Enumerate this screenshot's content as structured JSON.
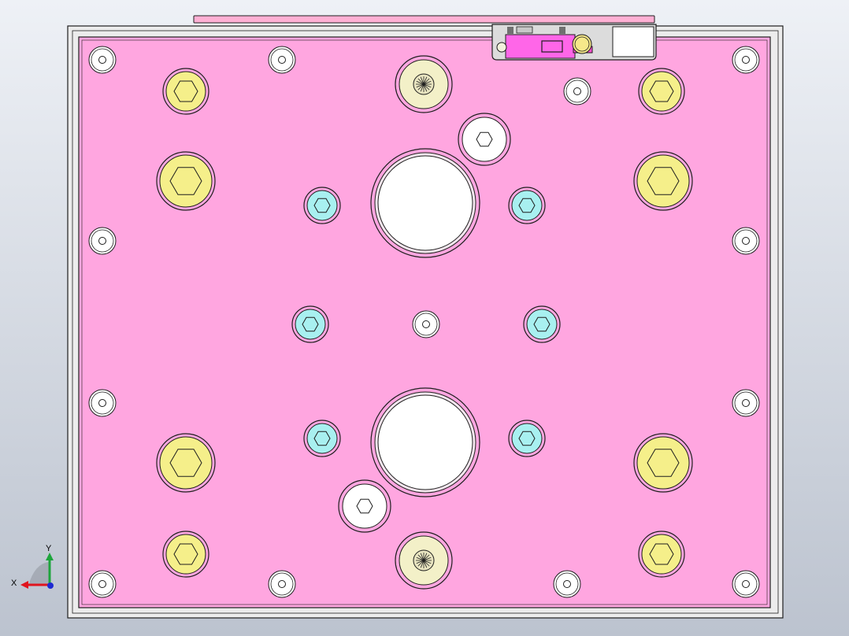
{
  "title": "",
  "view": {
    "background_top": "#eef1f6",
    "background_bottom": "#bcc3cf",
    "outline_color": "#1e1e1e"
  },
  "triad": {
    "x_label": "X",
    "y_label": "Y",
    "x_color": "#e0141e",
    "y_color": "#1ea53c",
    "z_color": "#1e2ad2"
  },
  "plate": {
    "base_color": "#ececec",
    "face_color": "#ffa6e0",
    "top_strip_color": "#ffb0d4",
    "pocket_color": "#dcdcdc"
  },
  "sensor": {
    "body_color": "#ff66e8",
    "label_color": "#ff4ed0",
    "lens_color": "#f6e88a"
  },
  "holes": {
    "large_bore_color": "#ffffff",
    "guide_bushing_color": "#f3f0c8",
    "large_cap_screw_color": "#f5ef8a",
    "small_cap_screw_color": "#a8f0f0",
    "washer_color": "#ffffff",
    "dowel_color": "#ffffff"
  }
}
